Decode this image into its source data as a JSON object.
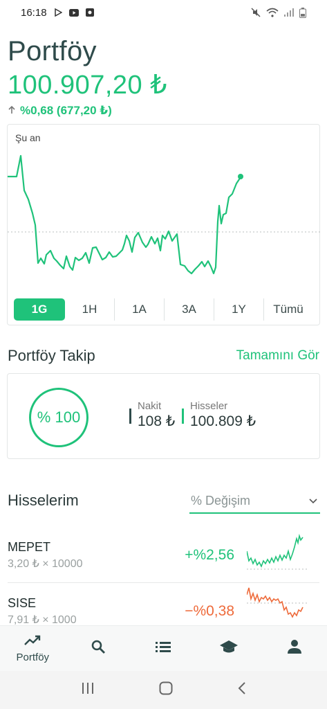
{
  "status_bar": {
    "time": "16:18"
  },
  "header": {
    "title": "Portföy",
    "value": "100.907,20 ₺",
    "change": "%0,68 (677,20 ₺)"
  },
  "chart": {
    "label": "Şu an",
    "ranges": [
      "1G",
      "1H",
      "1A",
      "3A",
      "1Y",
      "Tümü"
    ],
    "selected_range": "1G",
    "colors": {
      "line": "#1fc27a"
    }
  },
  "tracking": {
    "title": "Portföy Takip",
    "see_all": "Tamamını Gör",
    "ring_text": "% 100",
    "cash_label": "Nakit",
    "cash_value": "108 ₺",
    "stocks_label": "Hisseler",
    "stocks_value": "100.809 ₺"
  },
  "holdings": {
    "title": "Hisselerim",
    "sort_label": "% Değişim",
    "items": [
      {
        "symbol": "MEPET",
        "detail": "3,20 ₺ × 10000",
        "change": "+%2,56",
        "color": "#1fc27a"
      },
      {
        "symbol": "SISE",
        "detail": "7,91 ₺ × 1000",
        "change": "−%0,38",
        "color": "#ee6a3a"
      }
    ]
  },
  "bottom_nav": {
    "portfolio_label": "Portföy"
  }
}
